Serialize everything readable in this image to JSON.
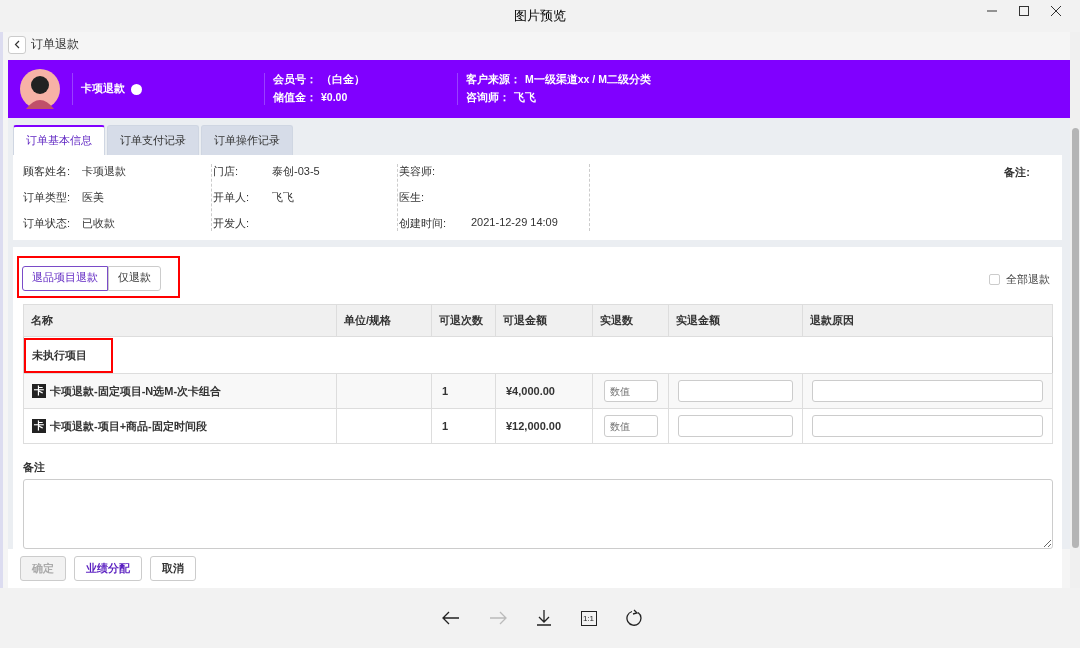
{
  "window": {
    "title": "图片预览"
  },
  "page": {
    "title": "订单退款"
  },
  "customer": {
    "name": "卡项退款",
    "online": true,
    "columns": [
      [
        {
          "label": "会员号：",
          "value": "（白金）"
        },
        {
          "label": "储值金：",
          "value": "¥0.00"
        }
      ],
      [
        {
          "label": "客户来源：",
          "value": "M一级渠道xx / M二级分类"
        },
        {
          "label": "咨询师：",
          "value": "飞飞"
        }
      ]
    ]
  },
  "tabs": [
    {
      "label": "订单基本信息",
      "selected": true
    },
    {
      "label": "订单支付记录",
      "selected": false
    },
    {
      "label": "订单操作记录",
      "selected": false
    }
  ],
  "info": {
    "columns": [
      [
        {
          "label": "顾客姓名:",
          "value": "卡项退款"
        },
        {
          "label": "订单类型:",
          "value": "医美"
        },
        {
          "label": "订单状态:",
          "value": "已收款"
        }
      ],
      [
        {
          "label": "门店:",
          "value": "泰创-03-5"
        },
        {
          "label": "开单人:",
          "value": "飞飞"
        },
        {
          "label": "开发人:"
        }
      ],
      [
        {
          "label": "美容师:"
        },
        {
          "label": "医生:"
        },
        {
          "label": "创建时间:",
          "value": "2021-12-29 14:09"
        }
      ]
    ],
    "remark_label": "备注:"
  },
  "refund_modes": {
    "highlighted": true,
    "options": [
      {
        "label": "退品项目退款",
        "selected": true
      },
      {
        "label": "仅退款",
        "selected": false
      }
    ]
  },
  "refund_all": {
    "label": "全部退款",
    "checked": false
  },
  "table": {
    "columns": [
      "名称",
      "单位/规格",
      "可退次数",
      "可退金额",
      "实退数",
      "实退金额",
      "退款原因"
    ],
    "groups": [
      {
        "title": "未执行项目",
        "highlighted": true,
        "rows": [
          {
            "badge": "卡",
            "name": "卡项退款-固定项目-N选M-次卡组合",
            "times": "1",
            "amount": "¥4,000.00",
            "qty_placeholder": "数值"
          },
          {
            "badge": "卡",
            "name": "卡项退款-项目+商品-固定时间段",
            "times": "1",
            "amount": "¥12,000.00",
            "qty_placeholder": "数值"
          }
        ]
      }
    ]
  },
  "remark": {
    "label": "备注"
  },
  "buttons": [
    {
      "label": "确定",
      "kind": "default",
      "disabled": true
    },
    {
      "label": "业绩分配",
      "kind": "primary",
      "disabled": false
    },
    {
      "label": "取消",
      "kind": "default",
      "disabled": false
    }
  ],
  "viewer_tools": [
    {
      "kind": "back",
      "disabled": false
    },
    {
      "kind": "forward",
      "disabled": true
    },
    {
      "kind": "download",
      "disabled": false
    },
    {
      "kind": "actual-size",
      "label": "1:1",
      "disabled": false
    },
    {
      "kind": "rotate",
      "disabled": false
    }
  ]
}
